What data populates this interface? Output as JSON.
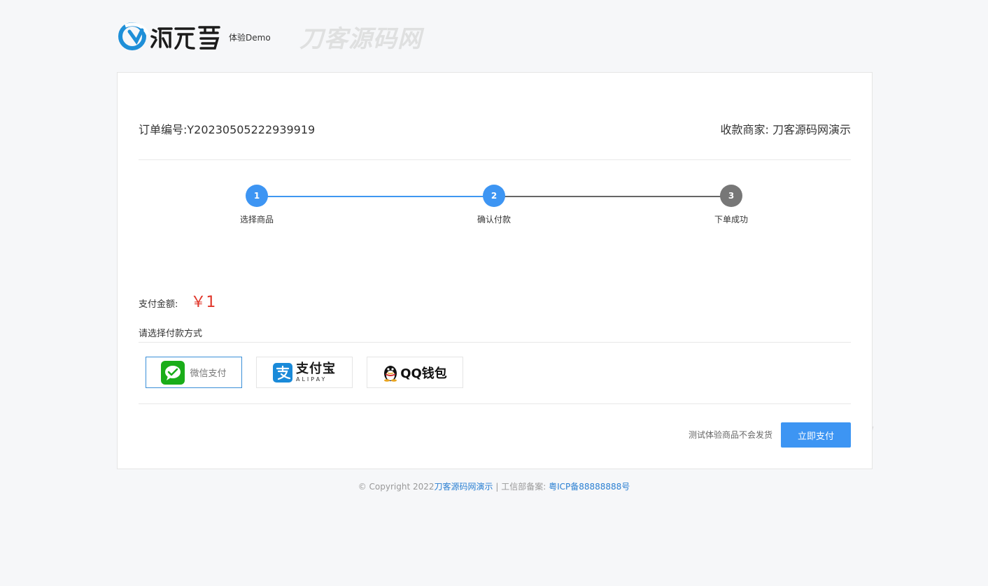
{
  "header": {
    "subtitle": "体验Demo"
  },
  "watermark": "刀客源码网",
  "order": {
    "number_label": "订单编号:Y20230505222939919",
    "merchant_label": "收款商家: 刀客源码网演示"
  },
  "steps": [
    {
      "number": "1",
      "label": "选择商品",
      "state": "done"
    },
    {
      "number": "2",
      "label": "确认付款",
      "state": "active"
    },
    {
      "number": "3",
      "label": "下单成功",
      "state": "todo"
    }
  ],
  "payment": {
    "amount_label": "支付金额:",
    "amount_value": "￥1",
    "method_title": "请选择付款方式",
    "methods": {
      "wechat": {
        "label": "微信支付",
        "selected": true
      },
      "alipay": {
        "label_cn": "支付宝",
        "label_en": "ALIPAY"
      },
      "qq": {
        "label": "QQ钱包"
      }
    },
    "note": "测试体验商品不会发货",
    "pay_button": "立即支付"
  },
  "footer": {
    "copyright": "© Copyright 2022",
    "site_link": "刀客源码网演示",
    "icp_label": " | 工信部备案:  ",
    "icp_link": "粤ICP备88888888号"
  },
  "colors": {
    "primary": "#3d95f3",
    "price": "#e0362a",
    "wechat_green": "#1aad19",
    "alipay_blue": "#1a8ad9"
  }
}
